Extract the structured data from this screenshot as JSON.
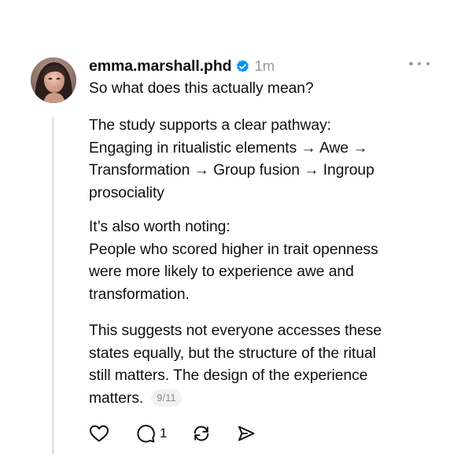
{
  "post": {
    "author": {
      "username": "emma.marshall.phd",
      "verified": true
    },
    "timestamp": "1m",
    "paragraphs": [
      [
        "So what does this actually mean?"
      ],
      [
        "The study supports a clear pathway:",
        "Engaging in ritualistic elements → Awe →",
        "Transformation → Group fusion → Ingroup",
        "prosociality"
      ],
      [
        "It’s also worth noting:",
        "People who scored higher in trait openness",
        "were more likely to experience awe and",
        "transformation."
      ],
      [
        "This suggests not everyone accesses these",
        "states equally, but the structure of the ritual",
        "still matters. The design of the experience",
        "matters."
      ]
    ],
    "thread_position": "9/11",
    "actions": {
      "like_icon": "heart-icon",
      "reply_icon": "comment-icon",
      "reply_count": "1",
      "repost_icon": "repost-icon",
      "share_icon": "send-icon"
    },
    "colors": {
      "verified_badge": "#0095f6",
      "muted_text": "#9a9a9a",
      "thread_line": "#e4e4e4"
    }
  }
}
